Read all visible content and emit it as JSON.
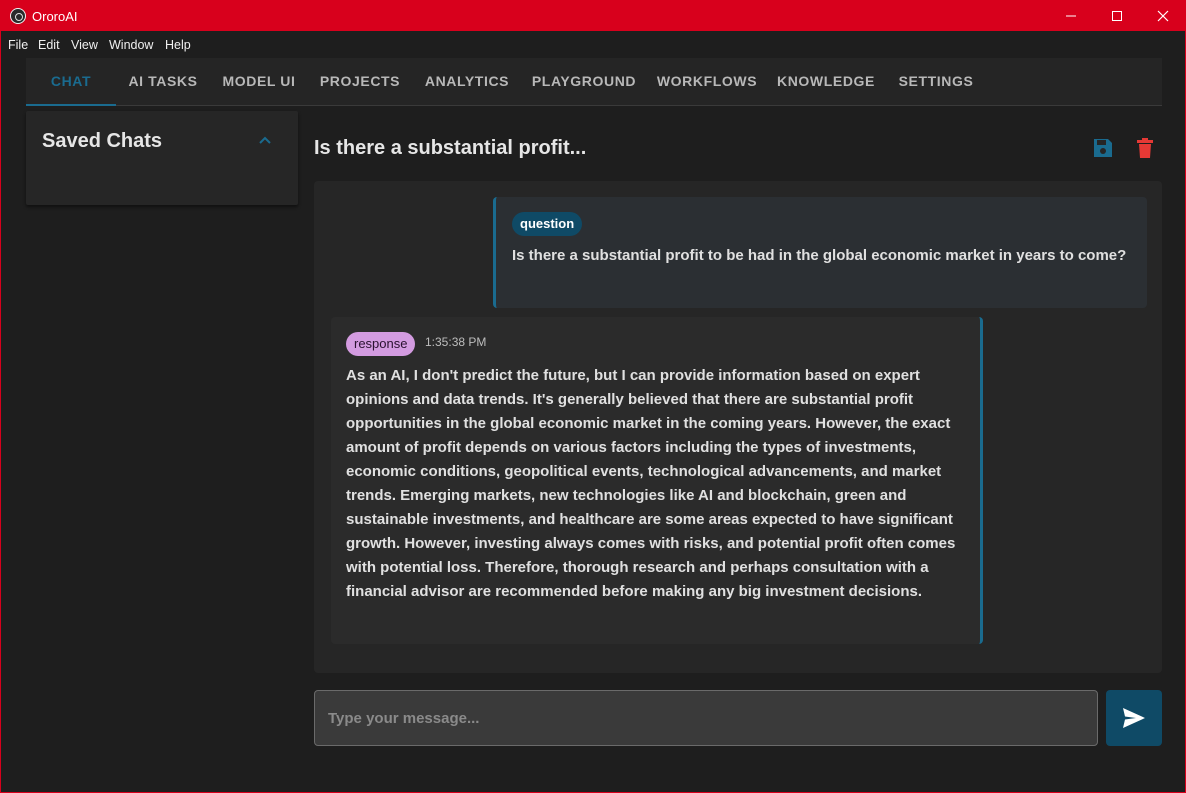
{
  "window": {
    "title": "OroroAI",
    "accent_color": "#d8001c"
  },
  "menu": {
    "items": [
      "File",
      "Edit",
      "View",
      "Window",
      "Help"
    ]
  },
  "tabs": [
    {
      "label": "CHAT",
      "active": true
    },
    {
      "label": "AI TASKS"
    },
    {
      "label": "MODEL UI"
    },
    {
      "label": "PROJECTS"
    },
    {
      "label": "ANALYTICS"
    },
    {
      "label": "PLAYGROUND"
    },
    {
      "label": "WORKFLOWS"
    },
    {
      "label": "KNOWLEDGE"
    },
    {
      "label": "SETTINGS"
    }
  ],
  "saved_chats": {
    "title": "Saved Chats",
    "expanded": true,
    "toggle_icon": "chevron-up-icon"
  },
  "chat": {
    "title": "Is there a substantial profit...",
    "save_icon": "save-icon",
    "delete_icon": "trash-icon",
    "messages": [
      {
        "role": "question",
        "text": "Is there a substantial profit to be had in the global economic market in years to come?"
      },
      {
        "role": "response",
        "timestamp": "1:35:38 PM",
        "text": "As an AI, I don't predict the future, but I can provide information based on expert opinions and data trends. It's generally believed that there are substantial profit opportunities in the global economic market in the coming years. However, the exact amount of profit depends on various factors including the types of investments, economic conditions, geopolitical events, technological advancements, and market trends. Emerging markets, new technologies like AI and blockchain, green and sustainable investments, and healthcare are some areas expected to have significant growth. However, investing always comes with risks, and potential profit often comes with potential loss. Therefore, thorough research and perhaps consultation with a financial advisor are recommended before making any big investment decisions."
      }
    ]
  },
  "input": {
    "placeholder": "Type your message...",
    "value": "",
    "send_icon": "send-icon"
  },
  "colors": {
    "primary": "#1a6b8f",
    "question_badge": "#0f4a66",
    "response_badge": "#d39be0",
    "delete": "#e53935"
  }
}
